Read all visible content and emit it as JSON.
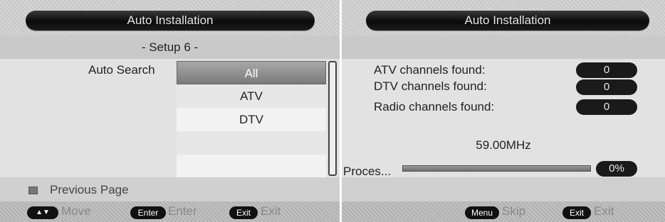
{
  "left": {
    "title": "Auto Installation",
    "subheader": "- Setup 6 -",
    "field_label": "Auto Search",
    "options": [
      "All",
      "ATV",
      "DTV",
      "",
      ""
    ],
    "selected_index": 0,
    "previous_page": "Previous Page",
    "footer": [
      {
        "key": "▲▼",
        "action": "Move"
      },
      {
        "key": "Enter",
        "action": "Enter"
      },
      {
        "key": "Exit",
        "action": "Exit"
      }
    ]
  },
  "right": {
    "title": "Auto Installation",
    "stats": [
      {
        "label": "ATV channels found:",
        "value": "0"
      },
      {
        "label": "DTV channels found:",
        "value": "0"
      },
      {
        "label": "Radio channels found:",
        "value": "0"
      }
    ],
    "frequency": "59.00MHz",
    "progress_label": "Proces...",
    "progress_text": "0%",
    "progress_value": 0,
    "footer": [
      {
        "key": "Menu",
        "action": "Skip"
      },
      {
        "key": "Exit",
        "action": "Exit"
      }
    ]
  }
}
